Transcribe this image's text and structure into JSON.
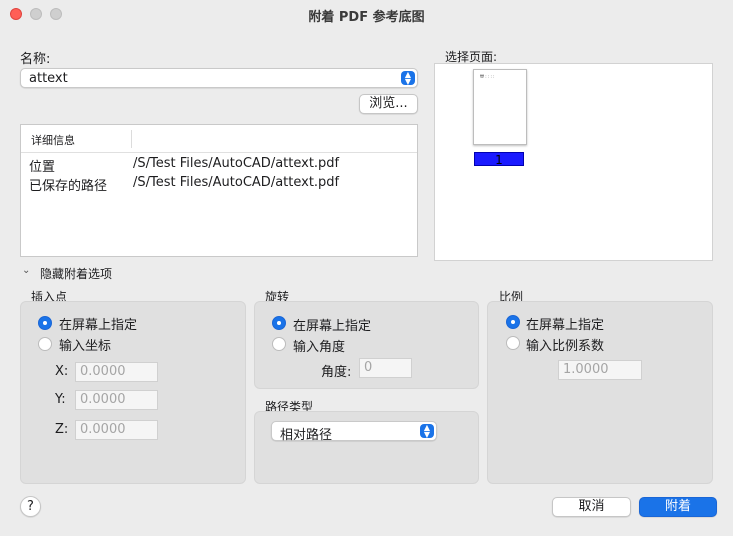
{
  "window": {
    "title": "附着 PDF 参考底图"
  },
  "name": {
    "label": "名称:",
    "value": "attext"
  },
  "browse": {
    "label": "浏览..."
  },
  "details": {
    "header": "详细信息",
    "rows": [
      {
        "key": "位置",
        "value": "/S/Test Files/AutoCAD/attext.pdf"
      },
      {
        "key": "已保存的路径",
        "value": "/S/Test Files/AutoCAD/attext.pdf"
      }
    ]
  },
  "pages": {
    "label": "选择页面:",
    "selected_page": "1",
    "thumb_text": "₩ : : : :"
  },
  "options_toggle": {
    "label": "隐藏附着选项"
  },
  "insertion": {
    "title": "插入点",
    "opt_screen": "在屏幕上指定",
    "opt_coords": "输入坐标",
    "x_label": "X:",
    "x_value": "0.0000",
    "y_label": "Y:",
    "y_value": "0.0000",
    "z_label": "Z:",
    "z_value": "0.0000"
  },
  "rotation": {
    "title": "旋转",
    "opt_screen": "在屏幕上指定",
    "opt_angle": "输入角度",
    "angle_label": "角度:",
    "angle_value": "0"
  },
  "path_type": {
    "title": "路径类型",
    "value": "相对路径"
  },
  "scale": {
    "title": "比例",
    "opt_screen": "在屏幕上指定",
    "opt_factor": "输入比例系数",
    "factor_value": "1.0000"
  },
  "buttons": {
    "help": "?",
    "cancel": "取消",
    "attach": "附着"
  },
  "colors": {
    "accent": "#1a73e8",
    "close": "#ff5f57",
    "page_highlight": "#1a1aff"
  }
}
